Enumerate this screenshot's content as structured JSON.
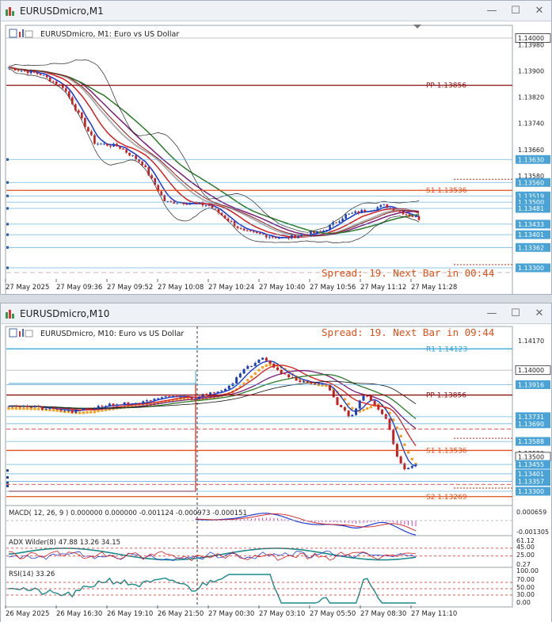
{
  "window1": {
    "title": "EURUSDmicro,M1",
    "header": "EURUSDmicro, M1:  Euro vs US Dollar",
    "price_labels": [
      {
        "text": "1.14000",
        "v": 1.14,
        "box": "#ffffff"
      },
      {
        "text": "1.13980",
        "v": 1.1398
      },
      {
        "text": "1.13900",
        "v": 1.139
      },
      {
        "text": "1.13820",
        "v": 1.1382
      },
      {
        "text": "1.13740",
        "v": 1.1374
      },
      {
        "text": "1.13660",
        "v": 1.1366
      },
      {
        "text": "1.13630",
        "v": 1.1363,
        "box": "#4aa3d6"
      },
      {
        "text": "1.13580",
        "v": 1.1358
      },
      {
        "text": "1.13560",
        "v": 1.1356,
        "box": "#4aa3d6"
      },
      {
        "text": "1.13519",
        "v": 1.13519,
        "box": "#4aa3d6"
      },
      {
        "text": "1.13500",
        "v": 1.135,
        "box": "#4aa3d6"
      },
      {
        "text": "1.13481",
        "v": 1.13481,
        "box": "#4aa3d6"
      },
      {
        "text": "1.13433",
        "v": 1.13433,
        "box": "#4aa3d6"
      },
      {
        "text": "1.13401",
        "v": 1.13401,
        "box": "#4aa3d6"
      },
      {
        "text": "1.13362",
        "v": 1.13362,
        "box": "#4aa3d6"
      },
      {
        "text": "1.13300",
        "v": 1.133,
        "box": "#4aa3d6"
      }
    ],
    "pivots": [
      {
        "text": "PP 1.13856",
        "v": 1.13856,
        "color": "#8b1010"
      },
      {
        "text": "S1 1.13536",
        "v": 1.13536,
        "color": "#e0501a"
      }
    ],
    "spread_text": "Spread: 19. Next Bar in 00:44",
    "time_labels": [
      "27 May 2025",
      "27 May 09:36",
      "27 May 09:52",
      "27 May 10:08",
      "27 May 10:24",
      "27 May 10:40",
      "27 May 10:56",
      "27 May 11:12",
      "27 May 11:28"
    ]
  },
  "window2": {
    "title": "EURUSDmicro,M10",
    "header": "EURUSDmicro, M10:  Euro vs US Dollar",
    "spread_text": "Spread: 19. Next Bar in 09:44",
    "price_labels": [
      {
        "text": "1.14170",
        "v": 1.1417
      },
      {
        "text": "1.14000",
        "v": 1.14,
        "box": "#ffffff"
      },
      {
        "text": "1.13916",
        "v": 1.13916,
        "box": "#4aa3d6"
      },
      {
        "text": "1.13731",
        "v": 1.13731,
        "box": "#4aa3d6"
      },
      {
        "text": "1.13690",
        "v": 1.1369,
        "box": "#4aa3d6"
      },
      {
        "text": "1.13520",
        "v": 1.1352
      },
      {
        "text": "1.13588",
        "v": 1.13588,
        "box": "#4aa3d6"
      },
      {
        "text": "1.13500",
        "v": 1.135,
        "box": "#ffffff"
      },
      {
        "text": "1.13455",
        "v": 1.13455,
        "box": "#4aa3d6"
      },
      {
        "text": "1.13401",
        "v": 1.13401,
        "box": "#4aa3d6"
      },
      {
        "text": "1.13357",
        "v": 1.13357,
        "box": "#4aa3d6"
      },
      {
        "text": "1.13300",
        "v": 1.133,
        "box": "#4aa3d6"
      }
    ],
    "pivots": [
      {
        "text": "R1 1.14123",
        "v": 1.14123,
        "color": "#2a9fd6"
      },
      {
        "text": "PP 1.13856",
        "v": 1.13856,
        "color": "#8b1010"
      },
      {
        "text": "S1 1.13536",
        "v": 1.13536,
        "color": "#e0501a"
      },
      {
        "text": "S2 1.13269",
        "v": 1.13269,
        "color": "#e0501a"
      }
    ],
    "macd": {
      "label": "MACD( 12, 26, 9 ) 0.000000 0.000000 -0.001124 -0.000973 -0.000151",
      "scale_top": "0.000659",
      "scale_bottom": "-0.001305"
    },
    "adx": {
      "label": "ADX Wilder(8) 47.88 13.26 34.15",
      "scale": [
        "61.12",
        "45.00",
        "25.00",
        "0.27"
      ]
    },
    "rsi": {
      "label": "RSI(14) 33.26",
      "scale": [
        "100.00",
        "70.00",
        "50.00",
        "30.00",
        "0.00"
      ]
    },
    "time_labels": [
      "26 May 2025",
      "26 May 16:30",
      "26 May 19:10",
      "26 May 21:50",
      "27 May 00:30",
      "27 May 03:10",
      "27 May 05:50",
      "27 May 08:30",
      "27 May 11:10"
    ]
  }
}
